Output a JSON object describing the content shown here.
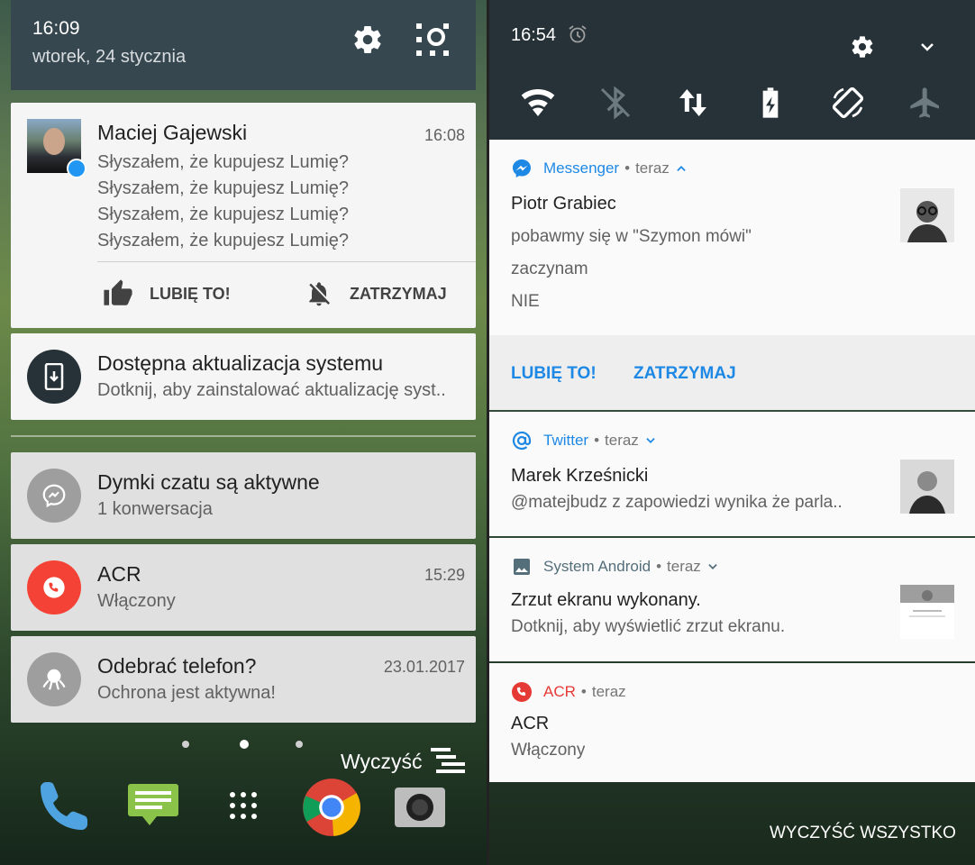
{
  "left": {
    "header": {
      "time": "16:09",
      "date": "wtorek, 24 stycznia"
    },
    "notifications": [
      {
        "title": "Maciej Gajewski",
        "time": "16:08",
        "lines": [
          "Słyszałem, że kupujesz Lumię?",
          "Słyszałem, że kupujesz Lumię?",
          "Słyszałem, że kupujesz Lumię?",
          "Słyszałem, że kupujesz Lumię?"
        ],
        "actions": [
          "LUBIĘ TO!",
          "ZATRZYMAJ"
        ]
      },
      {
        "title": "Dostępna aktualizacja systemu",
        "body": "Dotknij, aby zainstalować aktualizację syst.."
      },
      {
        "title": "Dymki czatu są aktywne",
        "body": "1 konwersacja"
      },
      {
        "title": "ACR",
        "body": "Włączony",
        "time": "15:29"
      },
      {
        "title": "Odebrać telefon?",
        "body": "Ochrona jest aktywna!",
        "time": "23.01.2017"
      }
    ],
    "clear_label": "Wyczyść",
    "colors": {
      "header": "#37474f",
      "acr": "#f44336",
      "update_icon": "#263238",
      "messenger_badge": "#2196f3"
    }
  },
  "right": {
    "header": {
      "time": "16:54"
    },
    "quick_settings": [
      "wifi-icon",
      "bluetooth-icon",
      "data-icon",
      "battery-saver-icon",
      "auto-rotate-icon",
      "airplane-icon"
    ],
    "notifications": [
      {
        "app": "Messenger",
        "when": "teraz",
        "title": "Piotr Grabiec",
        "lines": [
          "pobawmy się w \"Szymon mówi\"",
          "zaczynam",
          "NIE"
        ],
        "actions": [
          "LUBIĘ TO!",
          "ZATRZYMAJ"
        ]
      },
      {
        "app": "Twitter",
        "when": "teraz",
        "title": "Marek Krześnicki",
        "body": "@matejbudz z zapowiedzi wynika że parla.."
      },
      {
        "app": "System Android",
        "when": "teraz",
        "title": "Zrzut ekranu wykonany.",
        "body": "Dotknij, aby wyświetlić zrzut ekranu."
      },
      {
        "app": "ACR",
        "when": "teraz",
        "title": "ACR",
        "body": "Włączony"
      }
    ],
    "separator": "•",
    "clear_label": "WYCZYŚĆ WSZYSTKO",
    "colors": {
      "accent": "#1e88e5",
      "acr": "#e53935",
      "header": "#263238"
    }
  }
}
